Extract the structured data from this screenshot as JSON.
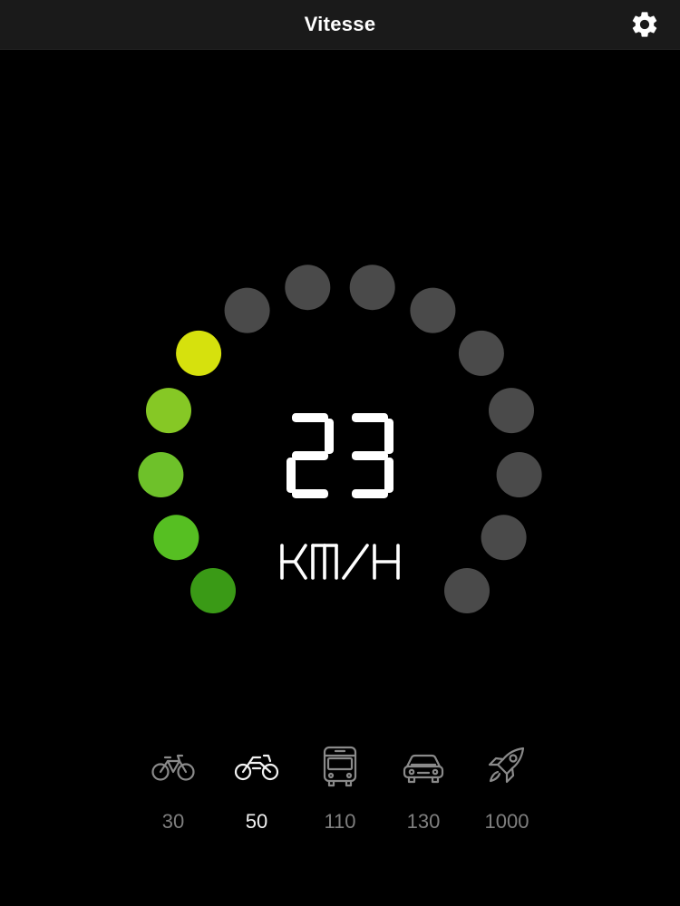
{
  "header": {
    "title": "Vitesse",
    "settings_icon": "gear-icon"
  },
  "speed": {
    "value": "23",
    "unit": "KM/H"
  },
  "gauge": {
    "segments_total": 14,
    "segments_lit": 5,
    "lit_colors": [
      "#3a9a16",
      "#56bf22",
      "#6ec12a",
      "#86c825",
      "#d6e10d"
    ],
    "off_color": "#4a4a4a"
  },
  "modes": [
    {
      "icon": "bicycle-icon",
      "limit": "30",
      "selected": false
    },
    {
      "icon": "motorbike-icon",
      "limit": "50",
      "selected": true
    },
    {
      "icon": "bus-icon",
      "limit": "110",
      "selected": false
    },
    {
      "icon": "car-icon",
      "limit": "130",
      "selected": false
    },
    {
      "icon": "rocket-icon",
      "limit": "1000",
      "selected": false
    }
  ]
}
